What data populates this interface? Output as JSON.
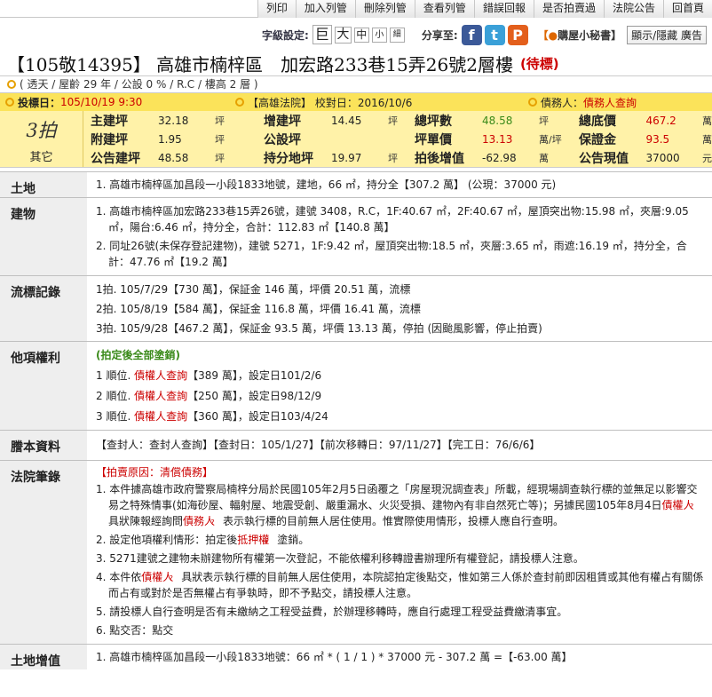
{
  "toolbar": [
    "列印",
    "加入列管",
    "刪除列管",
    "查看列管",
    "錯誤回報",
    "是否拍賣過",
    "法院公告",
    "回首頁"
  ],
  "fontbar": {
    "label": "字級設定:",
    "sizes": [
      "巨",
      "大",
      "中",
      "小",
      "細"
    ],
    "share_label": "分享至:",
    "share": [
      "f",
      "t",
      "P"
    ],
    "secretary": "購屋小秘書",
    "showhide": "顯示/隱藏 廣告"
  },
  "title": {
    "main": "【105敬14395】 高雄市楠梓區　加宏路233巷15弄26號2層樓",
    "status": "(待標)"
  },
  "subline": "( 透天 / 屋齡 29 年 / 公設 0 % / R.C / 樓高 2 層 )",
  "infobar": {
    "date_label": "投標日：",
    "date": "105/10/19 9:30",
    "court": "【高雄法院】 校對日：2016/10/6",
    "debtor_label": "債務人：",
    "debtor": "債務人查詢"
  },
  "pricebox": {
    "round": "3拍",
    "type": "其它",
    "cells": [
      {
        "label": "主建坪",
        "value": "32.18",
        "unit": "坪",
        "color": "normal"
      },
      {
        "label": "增建坪",
        "value": "14.45",
        "unit": "坪",
        "color": "normal"
      },
      {
        "label": "總坪數",
        "value": "48.58",
        "unit": "坪",
        "color": "green"
      },
      {
        "label": "總底價",
        "value": "467.2",
        "unit": "萬",
        "color": "red"
      },
      {
        "label": "附建坪",
        "value": "1.95",
        "unit": "坪",
        "color": "normal"
      },
      {
        "label": "公設坪",
        "value": "",
        "unit": "",
        "color": "normal"
      },
      {
        "label": "坪單價",
        "value": "13.13",
        "unit": "萬/坪",
        "color": "red"
      },
      {
        "label": "保證金",
        "value": "93.5",
        "unit": "萬",
        "color": "red"
      },
      {
        "label": "公告建坪",
        "value": "48.58",
        "unit": "坪",
        "color": "normal"
      },
      {
        "label": "持分地坪",
        "value": "19.97",
        "unit": "坪",
        "color": "normal"
      },
      {
        "label": "拍後增值",
        "value": "-62.98",
        "unit": "萬",
        "color": "normal"
      },
      {
        "label": "公告現值",
        "value": "37000",
        "unit": "元",
        "color": "normal"
      }
    ]
  },
  "sections": {
    "land_label": "土地",
    "land": "1. 高雄市楠梓區加昌段一小段1833地號，建地，66 ㎡，持分全【307.2 萬】 (公現：37000 元)",
    "building_label": "建物",
    "building": [
      "1. 高雄市楠梓區加宏路233巷15弄26號，建號 3408，R.C，1F:40.67 ㎡，2F:40.67 ㎡，屋頂突出物:15.98 ㎡，夾層:9.05 ㎡，陽台:6.46 ㎡，持分全，合計：112.83 ㎡【140.8 萬】",
      "2. 同址26號(未保存登記建物)，建號 5271，1F:9.42 ㎡，屋頂突出物:18.5 ㎡，夾層:3.65 ㎡，雨遮:16.19 ㎡，持分全，合計：47.76 ㎡【19.2 萬】"
    ],
    "history_label": "流標記錄",
    "history": [
      "1拍. 105/7/29【730 萬】，保証金 146 萬，坪價 20.51 萬，流標",
      "2拍. 105/8/19【584 萬】，保証金 116.8 萬，坪價 16.41 萬，流標",
      "3拍. 105/9/28【467.2 萬】，保証金 93.5 萬，坪價 13.13 萬，停拍 (因颱風影響，停止拍賣)"
    ],
    "rights_label": "他項權利",
    "rights_note": "(拍定後全部塗銷)",
    "rights": [
      {
        "prefix": "1 順位. ",
        "link": "債權人查詢",
        "rest": "【389 萬】，設定日101/2/6"
      },
      {
        "prefix": "2 順位. ",
        "link": "債權人查詢",
        "rest": "【250 萬】，設定日98/12/9"
      },
      {
        "prefix": "3 順位. ",
        "link": "債權人查詢",
        "rest": "【360 萬】，設定日103/4/24"
      }
    ],
    "transcript_label": "謄本資料",
    "transcript": "【查封人：查封人查詢】【查封日：105/1/27】【前次移轉日：97/11/27】【完工日：76/6/6】",
    "court_label": "法院筆錄",
    "court_reason": "【拍賣原因：清償債務】",
    "court_items": [
      {
        "segments": [
          "1. 本件據高雄市政府警察局楠梓分局於民國105年2月5日函覆之「房屋現況調查表」所載，經現場調查執行標的並無足以影響交易之特殊情事(如海砂屋、輻射屋、地震受創、嚴重漏水、火災受損、建物內有非自然死亡等)；另據民國105年8月4日",
          "債權人",
          "具狀陳報經詢問",
          "債務人",
          "表示執行標的目前無人居住使用。惟實際使用情形，投標人應自行查明。"
        ]
      },
      {
        "segments": [
          "2. 設定他項權利情形：拍定後",
          "抵押權",
          "塗銷。"
        ]
      },
      {
        "segments": [
          "3. 5271建號之建物未辦建物所有權第一次登記，不能依權利移轉證書辦理所有權登記，請投標人注意。"
        ]
      },
      {
        "segments": [
          "4. 本件依",
          "債權人",
          "具狀表示執行標的目前無人居住使用，本院認拍定後點交，惟如第三人係於查封前即因租賃或其他有權占有關係而占有或對於是否無權占有爭執時，即不予點交，請投標人注意。"
        ]
      },
      {
        "segments": [
          "5. 請投標人自行查明是否有未繳納之工程受益費，於辦理移轉時，應自行處理工程受益費繳清事宜。"
        ]
      },
      {
        "segments": [
          "6. 點交否：點交"
        ]
      }
    ],
    "increase_label": "土地增值",
    "increase": "1. 高雄市楠梓區加昌段一小段1833地號：66 ㎡ * ( 1 / 1 ) * 37000 元 - 307.2 萬 =【-63.00 萬】"
  }
}
